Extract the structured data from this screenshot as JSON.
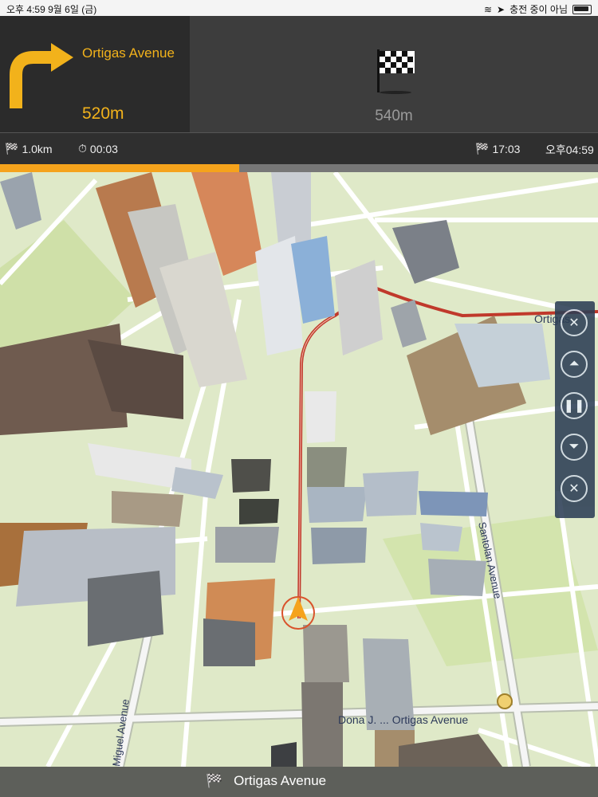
{
  "status_bar": {
    "time_date": "오후 4:59   9월 6일 (금)",
    "charging": "충전 중이 아님"
  },
  "turn": {
    "street": "Ortigas Avenue",
    "distance": "520m",
    "icon": "turn-right-arrow-icon"
  },
  "destination": {
    "distance": "540m",
    "icon": "checkered-flag-icon"
  },
  "info": {
    "remaining_distance": "1.0km",
    "remaining_time": "00:03",
    "eta": "17:03",
    "clock": "오후04:59",
    "progress": 0.4
  },
  "map": {
    "labels": {
      "road_top_right": "Ortigas",
      "road_right": "Santolan Avenue",
      "road_bottom": "Dona J. ... Ortigas Avenue",
      "road_bottom_left": "Miguel Avenue"
    }
  },
  "controls": [
    "zoom-out",
    "scroll-up",
    "pause",
    "scroll-down",
    "close"
  ],
  "bottom": {
    "street": "Ortigas Avenue"
  },
  "colors": {
    "accent": "#f2b21b",
    "route": "#c0392b",
    "map_bg": "#dfe9c8"
  }
}
